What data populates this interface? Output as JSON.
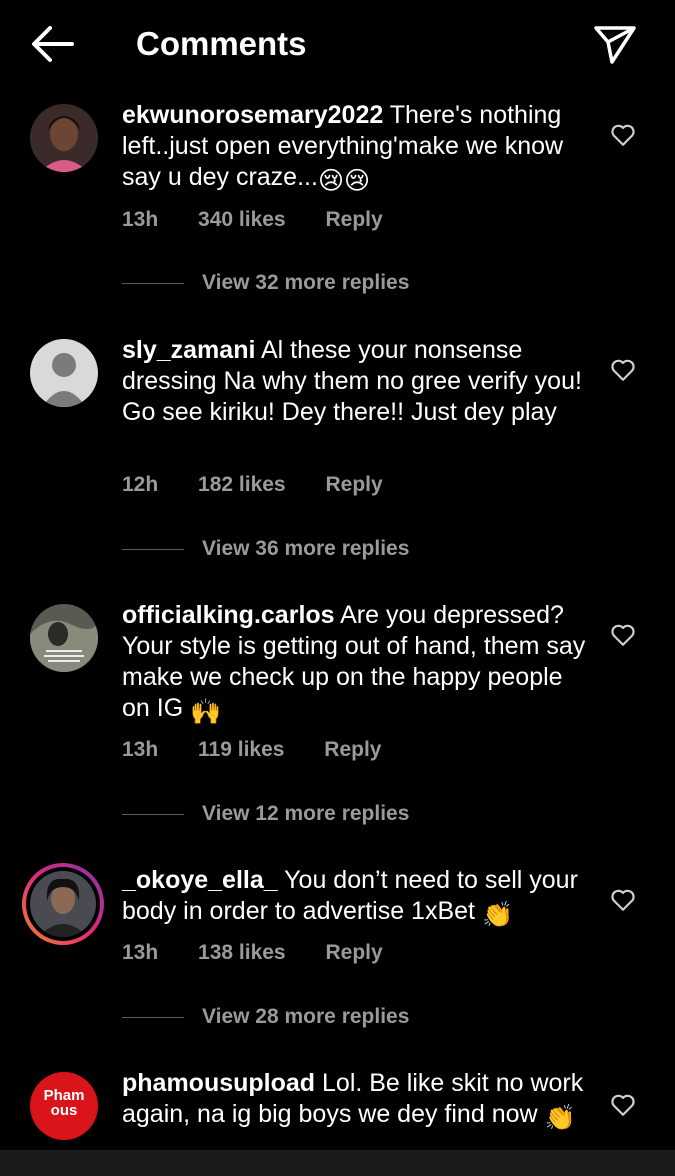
{
  "header": {
    "title": "Comments",
    "back_icon": "arrow-left-icon",
    "share_icon": "paper-plane-icon"
  },
  "comments": [
    {
      "username": "ekwunorosemary2022",
      "text": " There's nothing left..just open everything'make we know say u dey craze...",
      "emoji": "😢😢",
      "time": "13h",
      "likes": "340 likes",
      "reply": "Reply",
      "view_replies": "View 32 more replies"
    },
    {
      "username": "sly_zamani",
      "text": " Al these your nonsense dressing Na why them no gree verify you! Go see kiriku! Dey there!! Just dey play",
      "emoji": "",
      "time": "12h",
      "likes": "182 likes",
      "reply": "Reply",
      "view_replies": "View 36 more replies"
    },
    {
      "username": "officialking.carlos",
      "text": " Are you depressed? Your style is getting out of hand, them say make we check up on the happy people on IG ",
      "emoji": "🙌",
      "time": "13h",
      "likes": "119 likes",
      "reply": "Reply",
      "view_replies": "View 12 more replies"
    },
    {
      "username": "_okoye_ella_",
      "text": " You don’t need to sell your body in order to advertise 1xBet ",
      "emoji": "👏",
      "time": "13h",
      "likes": "138 likes",
      "reply": "Reply",
      "view_replies": "View 28 more replies"
    },
    {
      "username": "phamousupload",
      "text": " Lol. Be like skit no work again, na ig big boys we dey find now ",
      "emoji": "👏",
      "avatar_text": "Pham ous"
    }
  ],
  "colors": {
    "background": "#000000",
    "text": "#ffffff",
    "muted": "#9a9a9a",
    "story_ring": "#e1306c",
    "phamous_red": "#d9141b"
  }
}
